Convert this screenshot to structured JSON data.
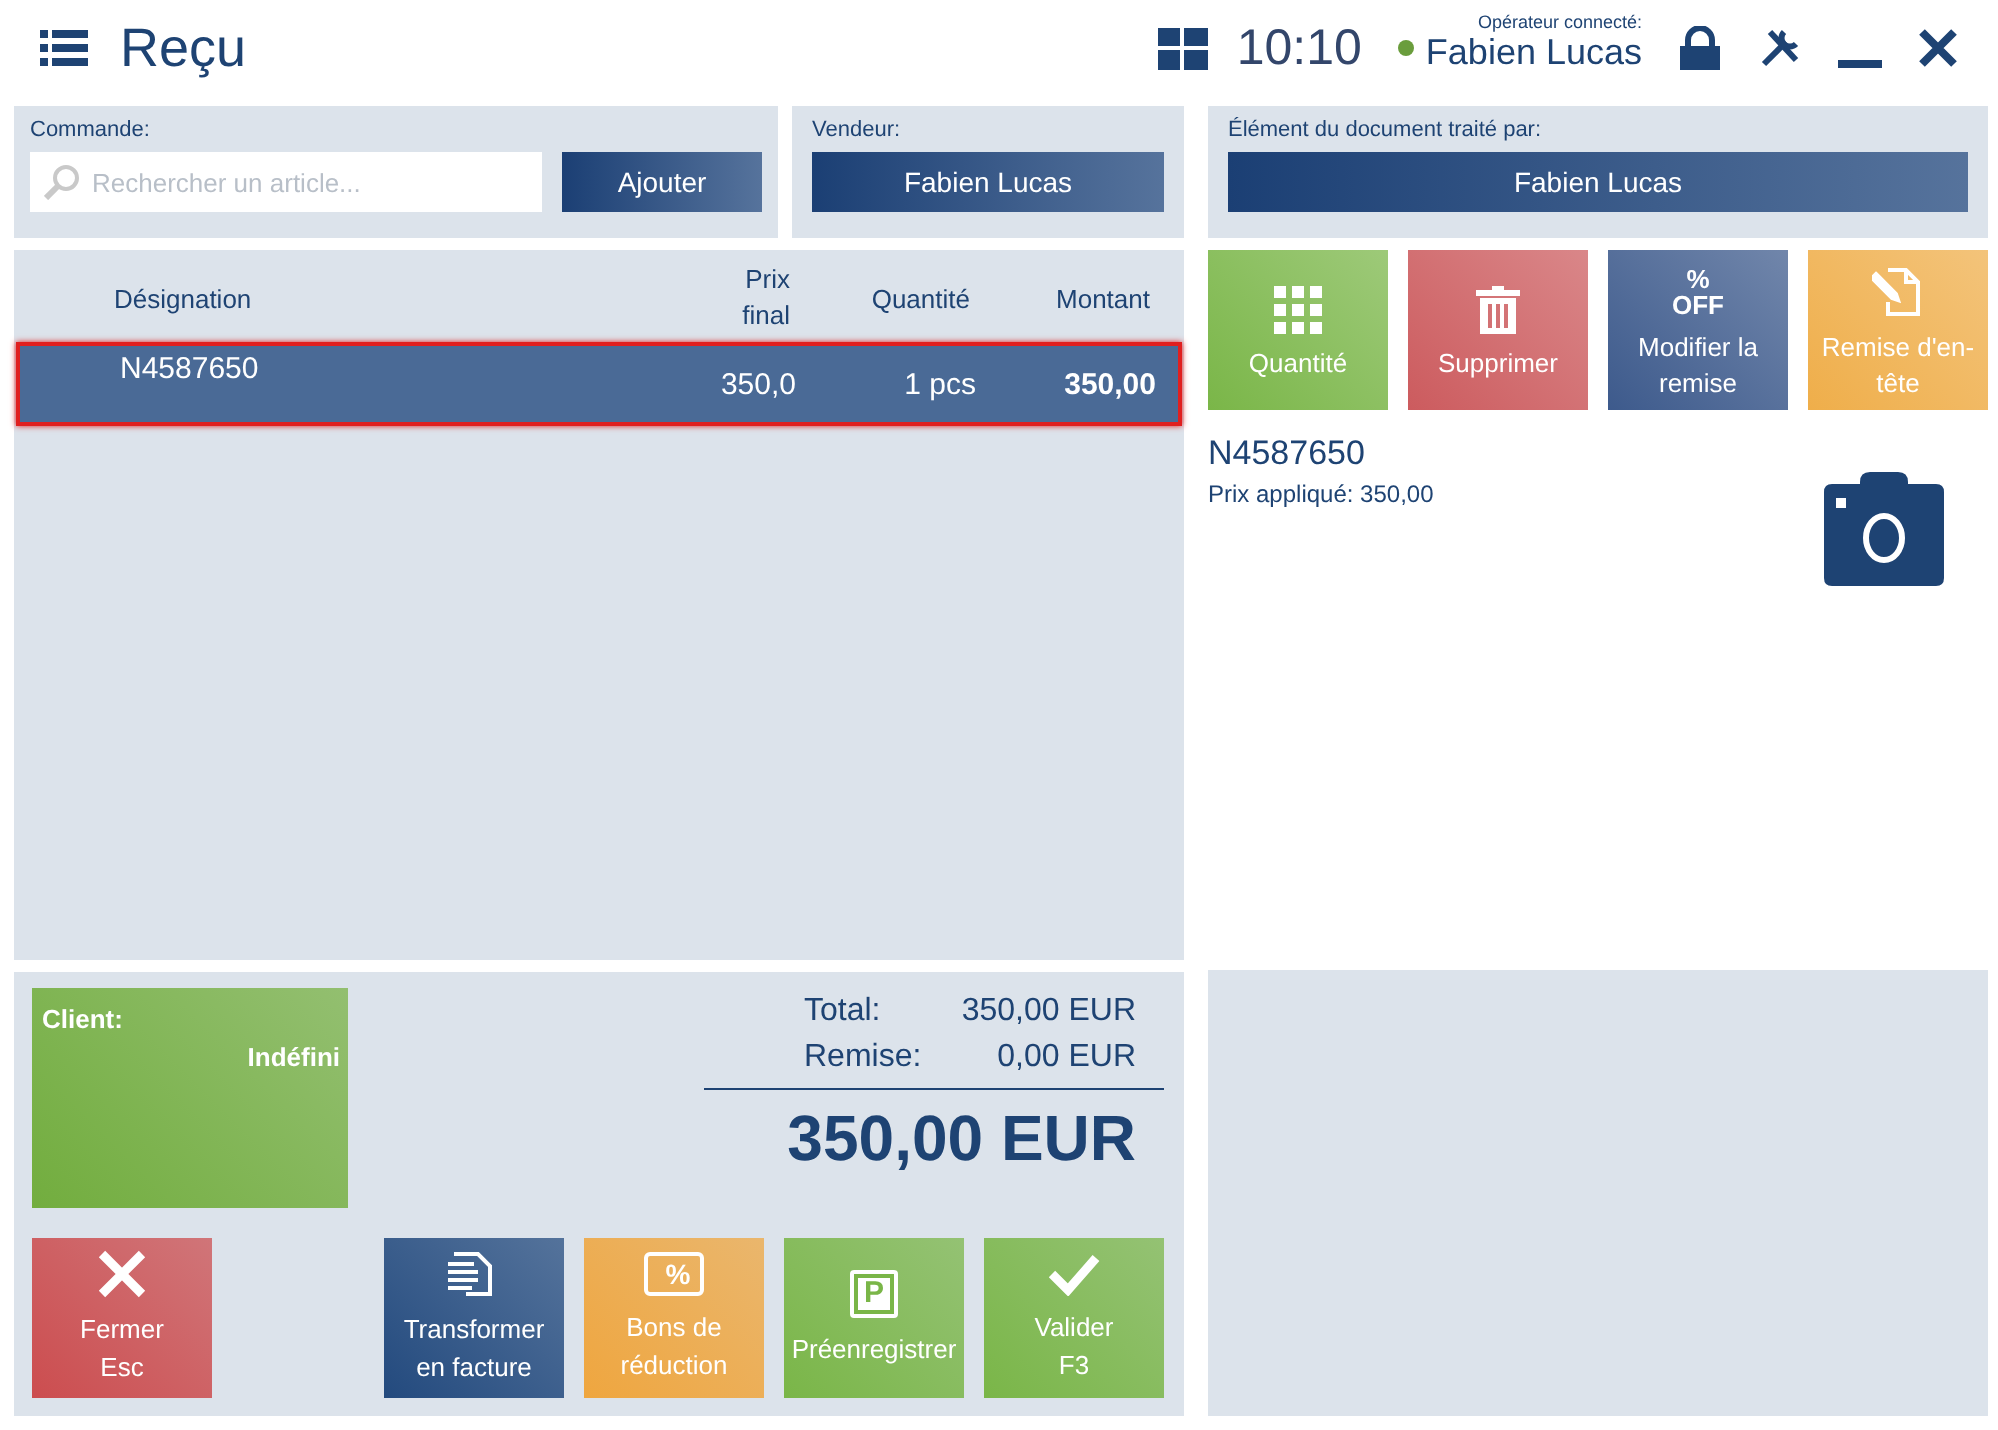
{
  "header": {
    "title": "Reçu",
    "time": "10:10",
    "operator_label": "Opérateur connecté:",
    "operator": "Fabien Lucas",
    "online": true
  },
  "order": {
    "label": "Commande:",
    "search_placeholder": "Rechercher un article...",
    "add_button": "Ajouter"
  },
  "seller": {
    "label": "Vendeur:",
    "name": "Fabien Lucas"
  },
  "table": {
    "columns": [
      "Désignation",
      "Prix final",
      "Quantité",
      "Montant"
    ],
    "rows": [
      {
        "designation": "N4587650",
        "price": "350,0",
        "quantity": "1 pcs",
        "amount": "350,00",
        "selected": true
      }
    ]
  },
  "processed_by": {
    "label": "Élément du document traité par:",
    "name": "Fabien Lucas"
  },
  "item_actions": [
    {
      "label": "Quantité",
      "kind": "grid",
      "color": "#7ab648"
    },
    {
      "label": "Supprimer",
      "kind": "trash",
      "color": "#cc5b5e"
    },
    {
      "label": "Modifier la remise",
      "kind": "percent-off",
      "icon_text": [
        "%",
        "OFF"
      ],
      "color": "#3d5a8c"
    },
    {
      "label": "Remise d'en-tête",
      "kind": "document-pencil",
      "color": "#efae4a"
    }
  ],
  "item_detail": {
    "code": "N4587650",
    "price": "Prix appliqué: 350,00"
  },
  "client": {
    "label": "Client:",
    "value": "Indéfini"
  },
  "totals": {
    "total_label": "Total:",
    "total": "350,00 EUR",
    "discount_label": "Remise:",
    "discount": "0,00 EUR",
    "grand_total": "350,00 EUR"
  },
  "footer_actions": [
    {
      "lines": [
        "Fermer",
        "Esc"
      ],
      "kind": "close",
      "color": "#cc4d4f",
      "separate": true
    },
    {
      "lines": [
        "Transformer",
        "en facture"
      ],
      "kind": "document-lines",
      "color": "#234a7e",
      "separate": false
    },
    {
      "lines": [
        "Bons de",
        "réduction"
      ],
      "kind": "coupon",
      "icon_text": [
        "%"
      ],
      "color": "#efa63f",
      "separate": false
    },
    {
      "lines": [
        "Préenregistrer"
      ],
      "kind": "parking",
      "icon_text": [
        "P"
      ],
      "color": "#7ab648",
      "separate": false
    },
    {
      "lines": [
        "Valider",
        "F3"
      ],
      "kind": "check",
      "color": "#7ab648",
      "separate": false
    }
  ]
}
